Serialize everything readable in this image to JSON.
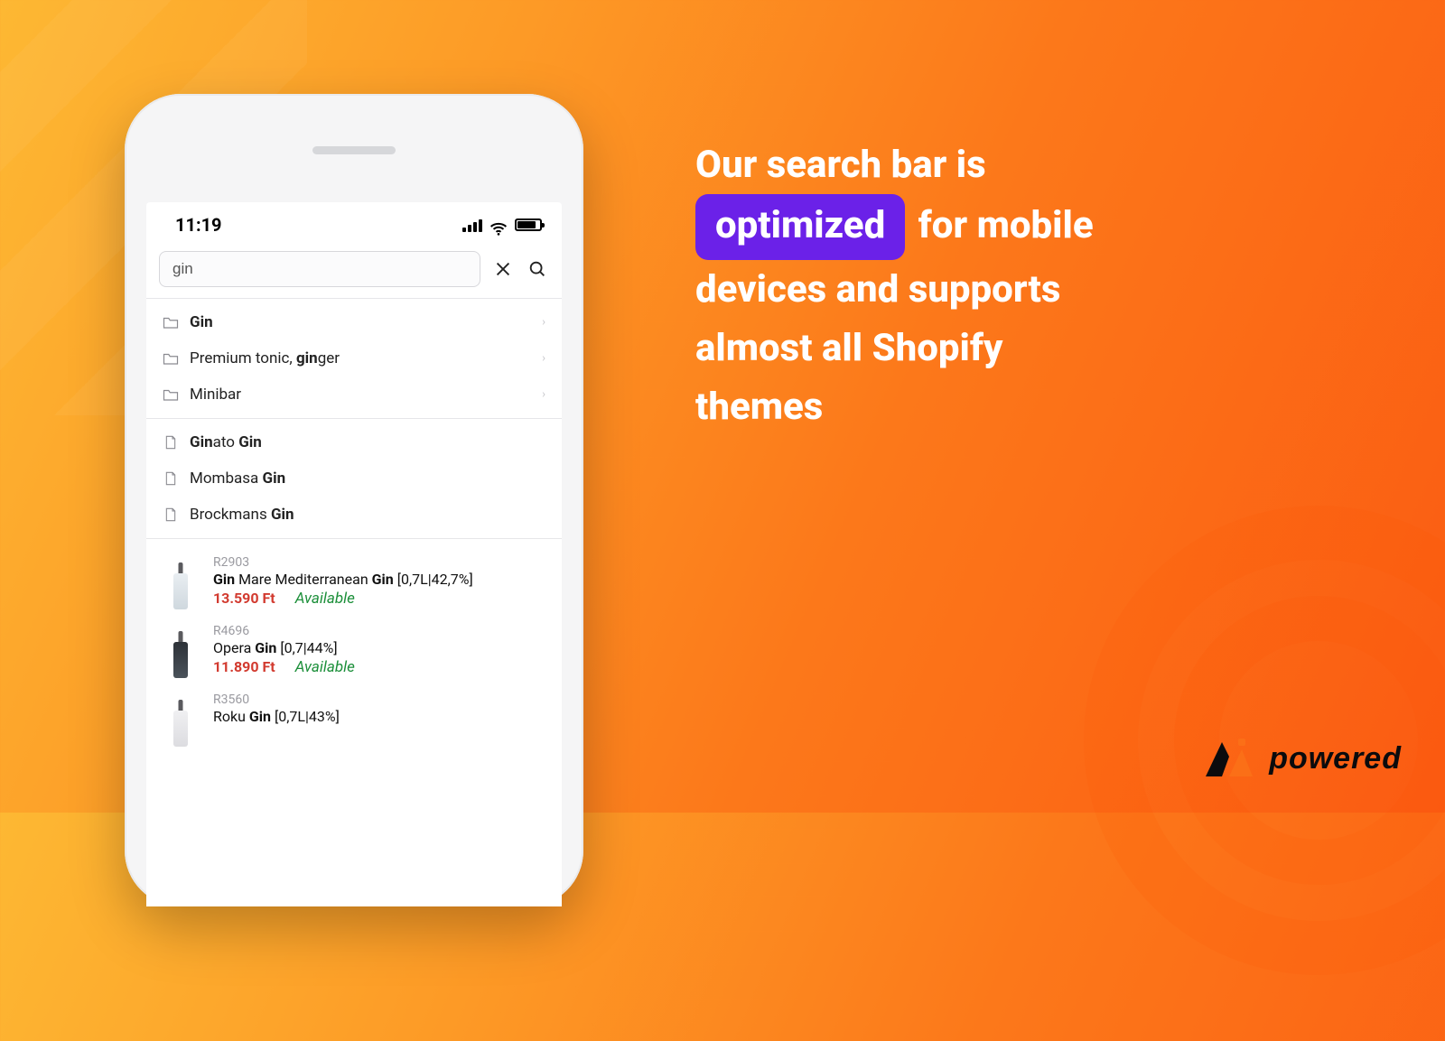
{
  "status": {
    "time": "11:19"
  },
  "search": {
    "value": "gin"
  },
  "categories": [
    {
      "pre": "",
      "bold": "Gin",
      "post": ""
    },
    {
      "pre": "Premium tonic, ",
      "bold": "gin",
      "post": "ger"
    },
    {
      "pre": "Minibar",
      "bold": "",
      "post": ""
    }
  ],
  "pages": [
    {
      "pre": "",
      "bold": "Gin",
      "mid": "ato ",
      "bold2": "Gin",
      "post": ""
    },
    {
      "pre": "Mombasa ",
      "bold": "Gin",
      "mid": "",
      "bold2": "",
      "post": ""
    },
    {
      "pre": "Brockmans ",
      "bold": "Gin",
      "mid": "",
      "bold2": "",
      "post": ""
    }
  ],
  "products": [
    {
      "sku": "R2903",
      "title_parts": {
        "b1": "Gin",
        "t1": " Mare Mediterranean ",
        "b2": "Gin",
        "t2": " [0,7L|42,7%]"
      },
      "price": "13.590 Ft",
      "availability": "Available",
      "bottle": "light"
    },
    {
      "sku": "R4696",
      "title_parts": {
        "b1": "",
        "t1": "Opera ",
        "b2": "Gin",
        "t2": " [0,7|44%]"
      },
      "price": "11.890 Ft",
      "availability": "Available",
      "bottle": "dark"
    },
    {
      "sku": "R3560",
      "title_parts": {
        "b1": "",
        "t1": "Roku ",
        "b2": "Gin",
        "t2": " [0,7L|43%]"
      },
      "price": "",
      "availability": "",
      "bottle": "clear"
    }
  ],
  "headline": {
    "l1_pre": "Our search bar is",
    "pill": "optimized",
    "l2_post": "for mobile",
    "l3": "devices and supports",
    "l4": "almost all Shopify",
    "l5": "themes"
  },
  "brand": {
    "word": "powered"
  }
}
